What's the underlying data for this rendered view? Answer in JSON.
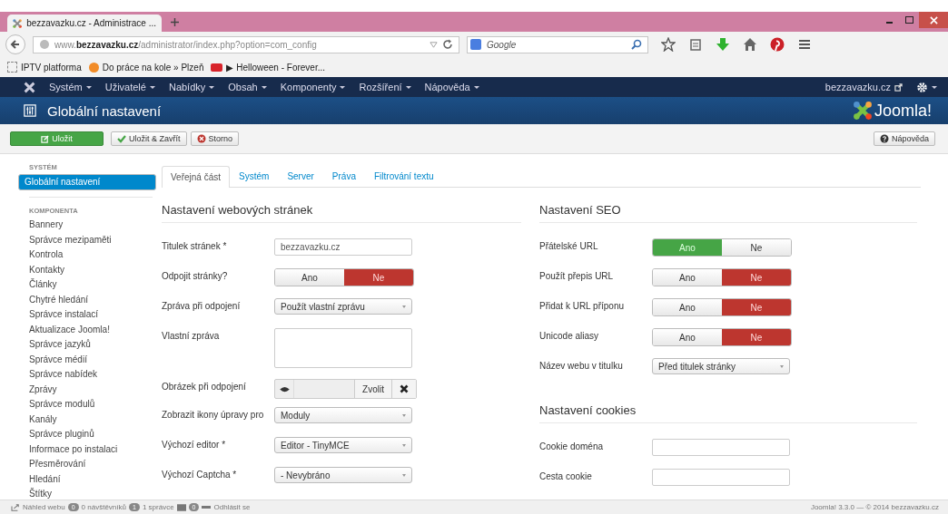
{
  "browser": {
    "tab_title": "bezzavazku.cz - Administrace ...",
    "url": "www.**bezzavazku.cz**/administrator/index.php?option=com_config",
    "search": {
      "placeholder": "Google"
    },
    "bookmarks": [
      {
        "kind": "page",
        "label": "IPTV platforma"
      },
      {
        "kind": "orange",
        "label": "Do práce na kole » Plzeň"
      },
      {
        "kind": "video",
        "label": "▶ Helloween - Forever..."
      }
    ]
  },
  "nav": {
    "items": [
      "Systém",
      "Uživatelé",
      "Nabídky",
      "Obsah",
      "Komponenty",
      "Rozšíření",
      "Nápověda"
    ],
    "site_link": "bezzavazku.cz"
  },
  "header": {
    "title": "Globální nastavení",
    "logo": "Joomla!"
  },
  "toolbar": {
    "buttons": [
      {
        "kind": "save",
        "label": "Uložit"
      },
      {
        "kind": "check",
        "label": "Uložit & Zavřít"
      },
      {
        "kind": "cancel",
        "label": "Storno"
      }
    ],
    "help": "Nápověda"
  },
  "sidebar": {
    "sections": [
      {
        "heading": "SYSTÉM",
        "items": [
          {
            "label": "Globální nastavení",
            "selected": true
          }
        ]
      },
      {
        "heading": "KOMPONENTA",
        "items": [
          {
            "label": "Bannery",
            "selected": false
          },
          {
            "label": "Správce mezipaměti",
            "selected": false
          },
          {
            "label": "Kontrola",
            "selected": false
          },
          {
            "label": "Kontakty",
            "selected": false
          },
          {
            "label": "Články",
            "selected": false
          },
          {
            "label": "Chytré hledání",
            "selected": false
          },
          {
            "label": "Správce instalací",
            "selected": false
          },
          {
            "label": "Aktualizace Joomla!",
            "selected": false
          },
          {
            "label": "Správce jazyků",
            "selected": false
          },
          {
            "label": "Správce médií",
            "selected": false
          },
          {
            "label": "Správce nabídek",
            "selected": false
          },
          {
            "label": "Zprávy",
            "selected": false
          },
          {
            "label": "Správce modulů",
            "selected": false
          },
          {
            "label": "Kanály",
            "selected": false
          },
          {
            "label": "Správce pluginů",
            "selected": false
          },
          {
            "label": "Informace po instalaci",
            "selected": false
          },
          {
            "label": "Přesměrování",
            "selected": false
          },
          {
            "label": "Hledání",
            "selected": false
          },
          {
            "label": "Štítky",
            "selected": false
          }
        ]
      }
    ]
  },
  "tabs": [
    {
      "label": "Veřejná část",
      "selected": true
    },
    {
      "label": "Systém",
      "selected": false
    },
    {
      "label": "Server",
      "selected": false
    },
    {
      "label": "Práva",
      "selected": false
    },
    {
      "label": "Filtrování textu",
      "selected": false
    }
  ],
  "left_column": {
    "sections": [
      {
        "heading": "Nastavení webových stránek",
        "fields": [
          {
            "kind": "text",
            "label": "Titulek stránek *",
            "value": "bezzavazku.cz"
          },
          {
            "kind": "toggle",
            "label": "Odpojit stránky?",
            "options": [
              {
                "label": "Ano",
                "selected": false
              },
              {
                "label": "Ne",
                "selected": true
              }
            ]
          },
          {
            "kind": "select",
            "label": "Zpráva při odpojení",
            "value": "Použít vlastní zprávu"
          },
          {
            "kind": "textarea",
            "label": "Vlastní zpráva"
          },
          {
            "kind": "media",
            "label": "Obrázek při odpojení",
            "button": "Zvolit"
          },
          {
            "kind": "select",
            "label": "Zobrazit ikony úpravy pro",
            "value": "Moduly"
          },
          {
            "kind": "select",
            "label": "Výchozí editor *",
            "value": "Editor - TinyMCE"
          },
          {
            "kind": "select",
            "label": "Výchozí Captcha *",
            "value": "- Nevybráno"
          }
        ]
      }
    ]
  },
  "right_column": {
    "sections": [
      {
        "heading": "Nastavení SEO",
        "fields": [
          {
            "kind": "toggle",
            "label": "Přátelské URL",
            "options": [
              {
                "label": "Ano",
                "selected": true
              },
              {
                "label": "Ne",
                "selected": false
              }
            ]
          },
          {
            "kind": "toggle",
            "label": "Použít přepis URL",
            "options": [
              {
                "label": "Ano",
                "selected": false
              },
              {
                "label": "Ne",
                "selected": true
              }
            ]
          },
          {
            "kind": "toggle",
            "label": "Přidat k URL příponu",
            "options": [
              {
                "label": "Ano",
                "selected": false
              },
              {
                "label": "Ne",
                "selected": true
              }
            ]
          },
          {
            "kind": "toggle",
            "label": "Unicode aliasy",
            "options": [
              {
                "label": "Ano",
                "selected": false
              },
              {
                "label": "Ne",
                "selected": true
              }
            ]
          },
          {
            "kind": "select",
            "label": "Název webu v titulku",
            "value": "Před titulek stránky"
          }
        ]
      },
      {
        "heading": "Nastavení cookies",
        "fields": [
          {
            "kind": "text",
            "label": "Cookie doména"
          },
          {
            "kind": "text",
            "label": "Cesta cookie"
          }
        ]
      }
    ]
  },
  "status_bar": {
    "preview": "Náhled webu",
    "visitors_count": "0",
    "visitors": "0 návštěvníků",
    "admins_count": "1",
    "admins": "1 správce",
    "messages_count": "0",
    "logout": "Odhlásit se",
    "version": "Joomla! 3.3.0 — © 2014 bezzavazku.cz"
  }
}
